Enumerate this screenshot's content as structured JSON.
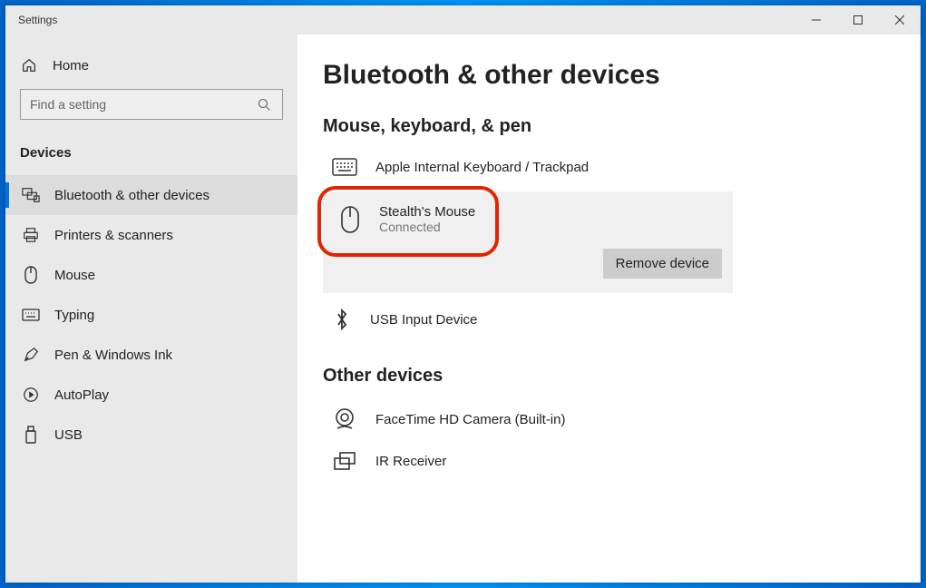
{
  "window": {
    "title": "Settings"
  },
  "sidebar": {
    "home": "Home",
    "search_placeholder": "Find a setting",
    "category": "Devices",
    "items": [
      {
        "label": "Bluetooth & other devices",
        "icon": "devices-icon",
        "active": true
      },
      {
        "label": "Printers & scanners",
        "icon": "printer-icon",
        "active": false
      },
      {
        "label": "Mouse",
        "icon": "mouse-icon",
        "active": false
      },
      {
        "label": "Typing",
        "icon": "keyboard-icon",
        "active": false
      },
      {
        "label": "Pen & Windows Ink",
        "icon": "pen-icon",
        "active": false
      },
      {
        "label": "AutoPlay",
        "icon": "autoplay-icon",
        "active": false
      },
      {
        "label": "USB",
        "icon": "usb-icon",
        "active": false
      }
    ]
  },
  "main": {
    "title": "Bluetooth & other devices",
    "section1": {
      "heading": "Mouse, keyboard, & pen",
      "devices": [
        {
          "name": "Apple Internal Keyboard / Trackpad",
          "icon": "keyboard-icon"
        },
        {
          "name": "Stealth's Mouse",
          "status": "Connected",
          "icon": "mouse-icon",
          "selected": true,
          "highlighted": true
        },
        {
          "name": "USB Input Device",
          "icon": "bluetooth-icon"
        }
      ],
      "remove_label": "Remove device"
    },
    "section2": {
      "heading": "Other devices",
      "devices": [
        {
          "name": "FaceTime HD Camera (Built-in)",
          "icon": "camera-icon"
        },
        {
          "name": "IR Receiver",
          "icon": "receiver-icon"
        }
      ]
    }
  }
}
